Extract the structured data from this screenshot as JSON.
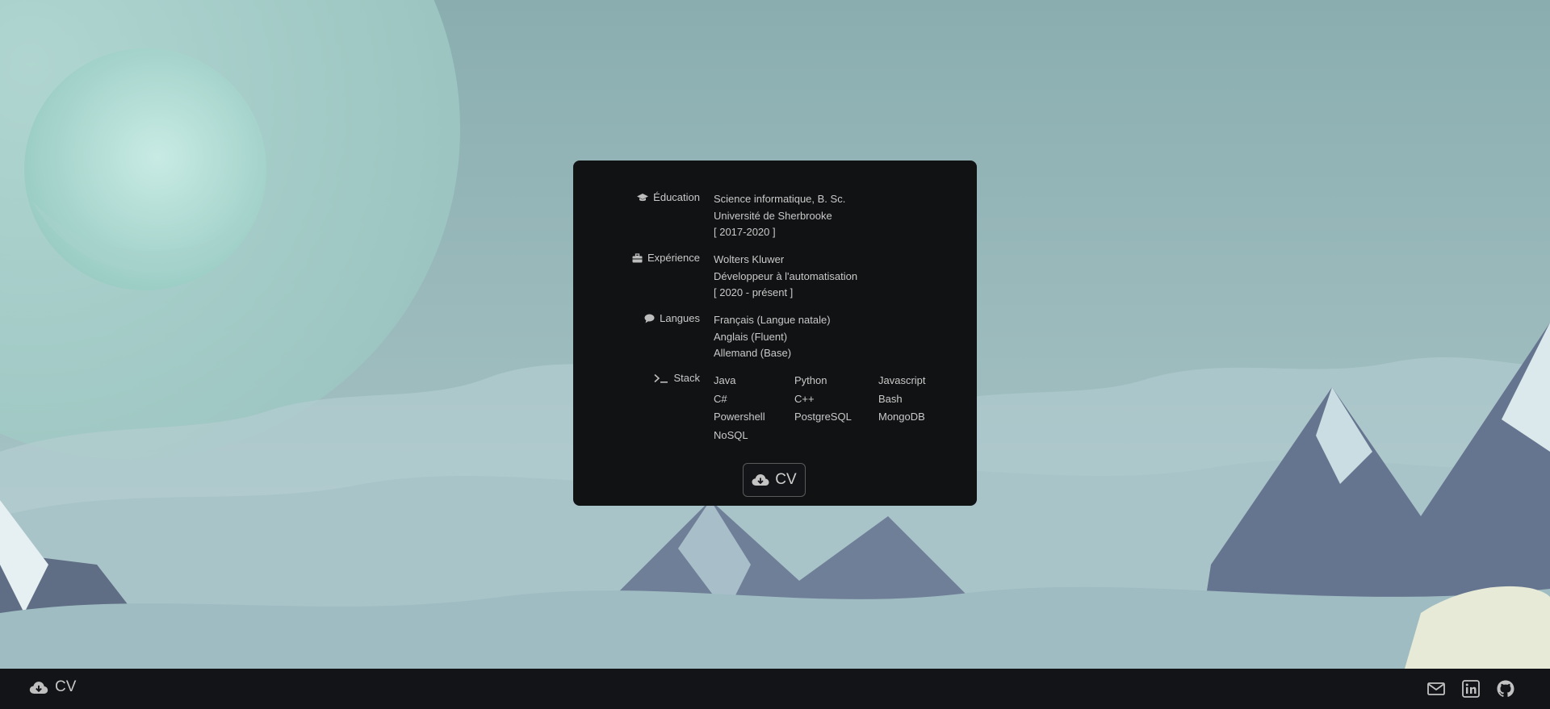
{
  "card": {
    "education": {
      "icon": "graduation-cap-icon",
      "label": "Éducation",
      "lines": [
        "Science informatique, B. Sc.",
        "Université de Sherbrooke",
        "[ 2017-2020 ]"
      ]
    },
    "experience": {
      "icon": "briefcase-icon",
      "label": "Expérience",
      "lines": [
        "Wolters Kluwer",
        "Développeur à l'automatisation",
        "[ 2020 - présent ]"
      ]
    },
    "languages": {
      "icon": "speech-bubble-icon",
      "label": "Langues",
      "lines": [
        "Français (Langue natale)",
        "Anglais (Fluent)",
        "Allemand (Base)"
      ]
    },
    "stack": {
      "icon": "terminal-icon",
      "label": "Stack",
      "items": [
        "Java",
        "Python",
        "Javascript",
        "C#",
        "C++",
        "Bash",
        "Powershell",
        "PostgreSQL",
        "MongoDB",
        "NoSQL"
      ]
    },
    "cv_button": {
      "icon": "cloud-download-icon",
      "label": "CV"
    }
  },
  "footer": {
    "cv_link": {
      "icon": "cloud-download-icon",
      "label": "CV"
    },
    "social": [
      "email-icon",
      "linkedin-icon",
      "github-icon"
    ]
  },
  "colors": {
    "card_bg": "#111214",
    "footer_bg": "#131417",
    "text": "#c9c9c9",
    "sky": "#8fb0b2"
  }
}
